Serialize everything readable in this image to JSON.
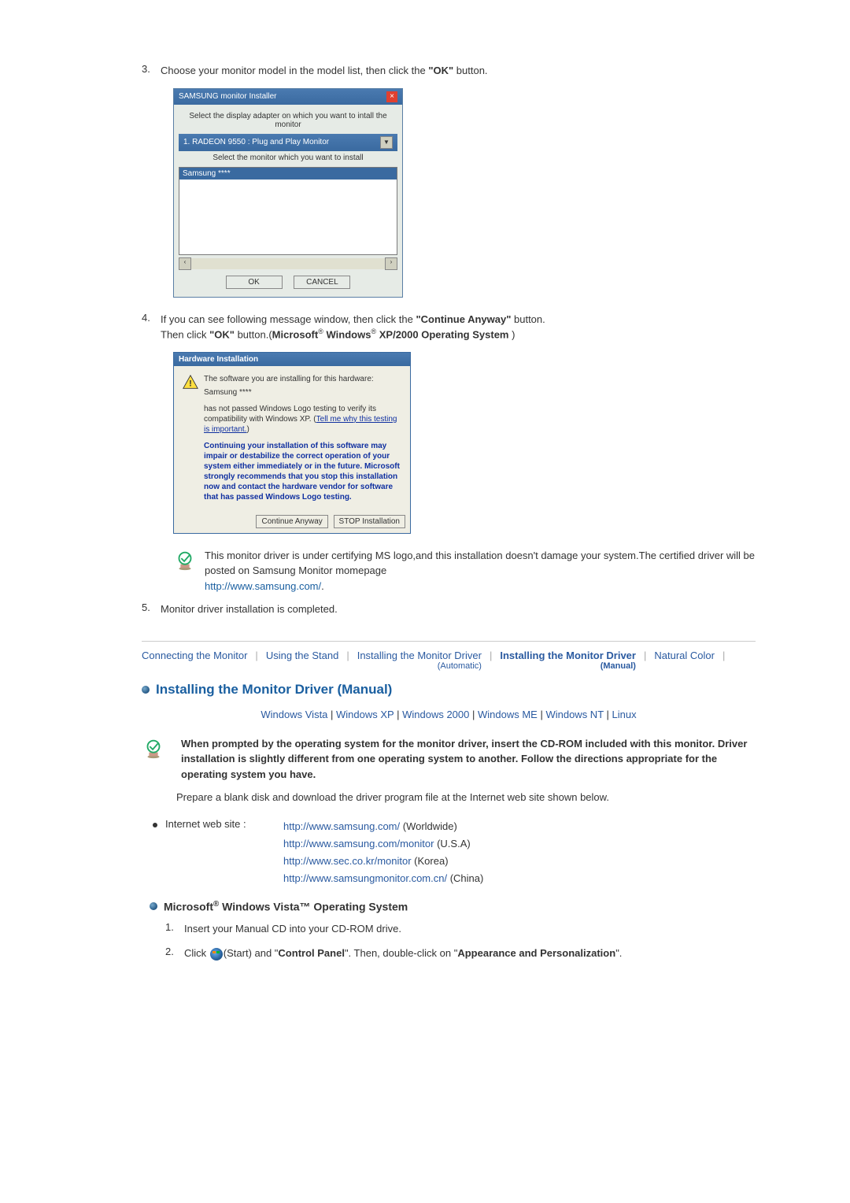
{
  "steps": {
    "s3": {
      "num": "3.",
      "text_pre": "Choose your monitor model in the model list, then click the ",
      "bold": "\"OK\"",
      "text_post": " button."
    },
    "s4": {
      "num": "4.",
      "line1_pre": "If you can see following message window, then click the ",
      "line1_bold": "\"Continue Anyway\"",
      "line1_post": " button. ",
      "line2_pre": "Then click ",
      "line2_b1": "\"OK\"",
      "line2_mid": " button.(",
      "line2_b2": "Microsoft",
      "line2_r1": "®",
      "line2_b3": " Windows",
      "line2_r2": "®",
      "line2_b4": " XP/2000 Operating System",
      "line2_post": " )"
    },
    "s5": {
      "num": "5.",
      "text": "Monitor driver installation is completed."
    }
  },
  "installer": {
    "title": "SAMSUNG monitor Installer",
    "sub1": "Select the display adapter on which you want to intall the monitor",
    "dropdown": "1. RADEON 9550 : Plug and Play Monitor",
    "sub2": "Select the monitor which you want to install",
    "selected": "Samsung ****",
    "ok": "OK",
    "cancel": "CANCEL"
  },
  "hw": {
    "title": "Hardware Installation",
    "l1": "The software you are installing for this hardware:",
    "l2": "Samsung ****",
    "l3a": "has not passed Windows Logo testing to verify its compatibility with Windows XP. (",
    "l3link": "Tell me why this testing is important.",
    "l3b": ")",
    "warn": "Continuing your installation of this software may impair or destabilize the correct operation of your system either immediately or in the future. Microsoft strongly recommends that you stop this installation now and contact the hardware vendor for software that has passed Windows Logo testing.",
    "btn1": "Continue Anyway",
    "btn2": "STOP Installation"
  },
  "note": {
    "text": "This monitor driver is under certifying MS logo,and this installation doesn't damage your system.The certified driver will be posted on Samsung Monitor momepage",
    "link": "http://www.samsung.com/",
    "dot": "."
  },
  "tabs": {
    "t1": "Connecting  the Monitor",
    "t2": "Using the Stand",
    "t3": "Installing the Monitor Driver",
    "t3sub": "(Automatic)",
    "t4": "Installing the Monitor Driver",
    "t4sub": "(Manual)",
    "t5": "Natural Color"
  },
  "section": {
    "title": "Installing the Monitor Driver (Manual)"
  },
  "oslinks": {
    "vista": "Windows Vista",
    "xp": "Windows XP",
    "w2k": "Windows 2000",
    "me": "Windows ME",
    "nt": "Windows NT",
    "linux": "Linux"
  },
  "prompt": "When prompted by the operating system for the monitor driver, insert the CD-ROM included with this monitor. Driver installation is slightly different from one operating system to another. Follow the directions appropriate for the operating system you have.",
  "prep": "Prepare a blank disk and download the driver program file at the Internet web site shown below.",
  "internet": {
    "label": "Internet web site :",
    "u1": "http://www.samsung.com/",
    "u1t": " (Worldwide)",
    "u2": "http://www.samsung.com/monitor",
    "u2t": " (U.S.A)",
    "u3": "http://www.sec.co.kr/monitor",
    "u3t": " (Korea)",
    "u4": "http://www.samsungmonitor.com.cn/",
    "u4t": " (China)"
  },
  "vistahead": {
    "pre": "Microsoft",
    "r": "®",
    "mid": " Windows Vista™ Operating System"
  },
  "vsteps": {
    "v1": {
      "num": "1.",
      "text": "Insert your Manual CD into your CD-ROM drive."
    },
    "v2": {
      "num": "2.",
      "pre": "Click ",
      "start": "(Start) and \"",
      "b1": "Control Panel",
      "mid": "\". Then, double-click on \"",
      "b2": "Appearance and Personalization",
      "post": "\"."
    }
  }
}
